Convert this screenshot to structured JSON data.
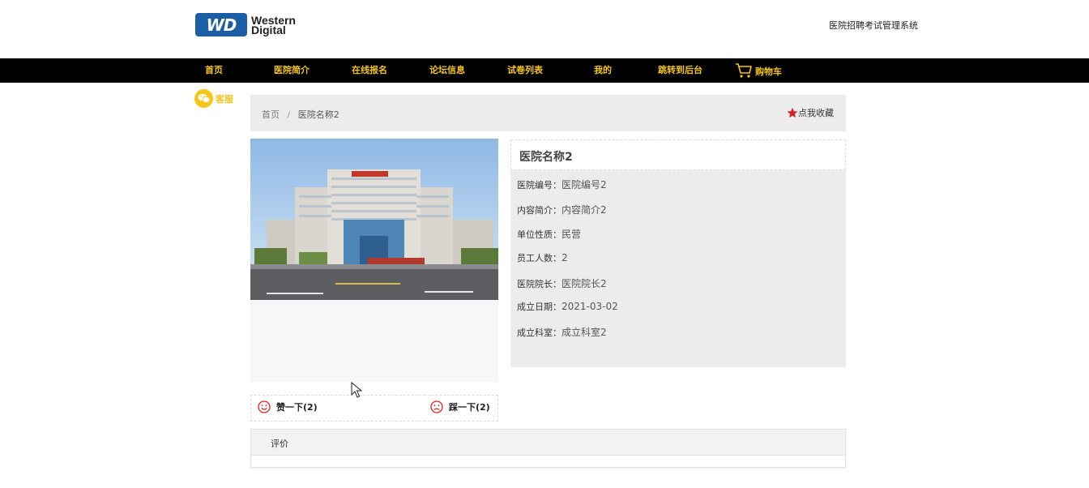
{
  "header": {
    "logo_mark": "WD",
    "logo_line1": "Western",
    "logo_line2": "Digital",
    "site_title": "医院招聘考试管理系统"
  },
  "nav": {
    "items": [
      "首页",
      "医院简介",
      "在线报名",
      "论坛信息",
      "试卷列表",
      "我的",
      "跳转到后台",
      "购物车"
    ]
  },
  "service": {
    "label": "客服"
  },
  "breadcrumb": {
    "home": "首页",
    "separator": "/",
    "current": "医院名称2"
  },
  "favorite": {
    "label": "点我收藏"
  },
  "votes": {
    "like_label": "赞一下(2)",
    "dislike_label": "踩一下(2)"
  },
  "detail": {
    "title": "医院名称2",
    "fields": [
      {
        "label": "医院编号：",
        "value": "医院编号2"
      },
      {
        "label": "内容简介：",
        "value": "内容简介2"
      },
      {
        "label": "单位性质：",
        "value": "民营"
      },
      {
        "label": "员工人数：",
        "value": "2"
      },
      {
        "label": "医院院长：",
        "value": "医院院长2"
      },
      {
        "label": "成立日期：",
        "value": "2021-03-02"
      },
      {
        "label": "成立科室：",
        "value": "成立科室2"
      }
    ]
  },
  "review": {
    "tab_label": "评价"
  },
  "colors": {
    "accent": "#f5c518",
    "nav_bg": "#000000",
    "panel_bg": "#ececec",
    "icon_red": "#e02020",
    "logo_blue": "#1b5ea8"
  }
}
